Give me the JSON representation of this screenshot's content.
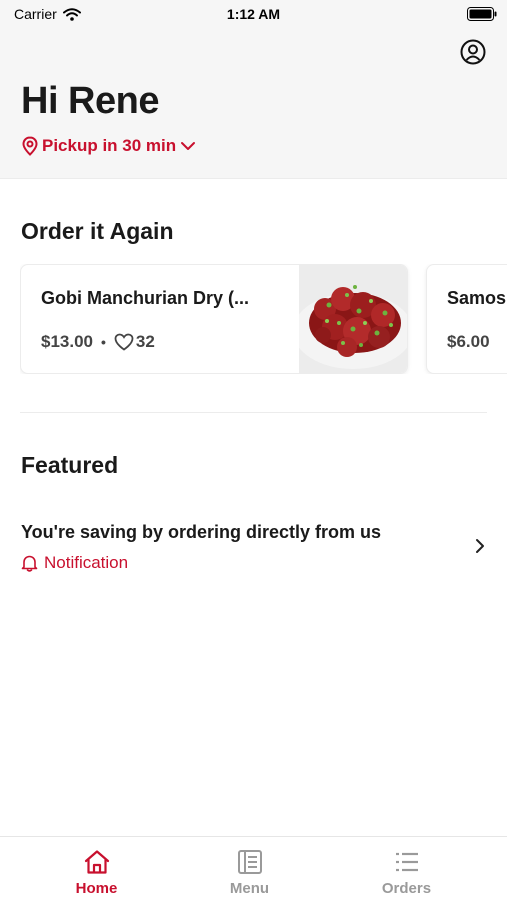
{
  "status_bar": {
    "carrier": "Carrier",
    "time": "1:12 AM"
  },
  "header": {
    "greeting": "Hi Rene",
    "pickup_label": "Pickup in 30 min"
  },
  "order_again": {
    "title": "Order it Again",
    "items": [
      {
        "name": "Gobi Manchurian Dry (...",
        "price": "$13.00",
        "separator": "•",
        "likes": "32"
      },
      {
        "name": "Samos",
        "price": "$6.00"
      }
    ]
  },
  "featured": {
    "title": "Featured",
    "promo_text": "You're saving by ordering directly from us",
    "promo_sub": "Notification"
  },
  "tabs": [
    {
      "label": "Home",
      "icon": "home-icon",
      "active": true
    },
    {
      "label": "Menu",
      "icon": "menu-book-icon",
      "active": false
    },
    {
      "label": "Orders",
      "icon": "list-icon",
      "active": false
    }
  ],
  "colors": {
    "accent": "#c8102e",
    "header_bg": "#f6f6f6",
    "inactive": "#9a9a9a"
  }
}
